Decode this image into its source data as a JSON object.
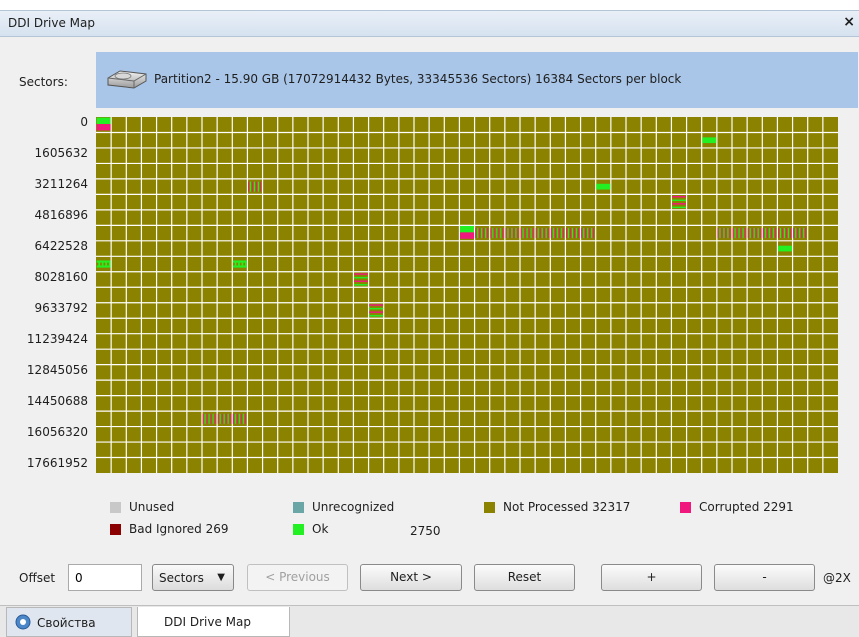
{
  "window": {
    "title": "DDI Drive Map",
    "close_glyph": "×"
  },
  "header": {
    "sectors_label": "Sectors:",
    "partition_text": "Partition2 - 15.90 GB (17072914432 Bytes, 33345536 Sectors) 16384 Sectors per block",
    "icon": "hard-disk-icon"
  },
  "row_labels": [
    "0",
    "1605632",
    "3211264",
    "4816896",
    "6422528",
    "8028160",
    "9633792",
    "11239424",
    "12845056",
    "14450688",
    "16056320",
    "17661952"
  ],
  "map": {
    "columns": 49,
    "rows": 23,
    "colors": {
      "not_processed": "#8b8200",
      "ok": "#22f022",
      "corrupted": "#f0187c",
      "bad_ignored": "#8b0000",
      "unrecognized": "#6aa6a6",
      "unused": "#c8c8c8",
      "gridline": "#ffffff"
    }
  },
  "legend": [
    {
      "label": "Unused",
      "color": "#c8c8c8"
    },
    {
      "label": "Unrecognized",
      "color": "#6aa6a6"
    },
    {
      "label": "Not Processed 32317",
      "color": "#8b8200"
    },
    {
      "label": "Corrupted 2291",
      "color": "#f0187c"
    },
    {
      "label": "Bad Ignored 269",
      "color": "#8b0000"
    },
    {
      "label": "Ok",
      "color": "#22f022"
    },
    {
      "label": "2750",
      "color": ""
    }
  ],
  "controls": {
    "offset_label": "Offset",
    "offset_value": "0",
    "unit_select": "Sectors",
    "previous": "< Previous",
    "next": "Next >",
    "reset": "Reset",
    "zoom_in": "+",
    "zoom_out": "-",
    "zoom_level": "@2X"
  },
  "tabs": [
    {
      "label": "Свойства",
      "icon": "properties-icon",
      "active": false
    },
    {
      "label": "DDI Drive Map",
      "active": true
    }
  ]
}
